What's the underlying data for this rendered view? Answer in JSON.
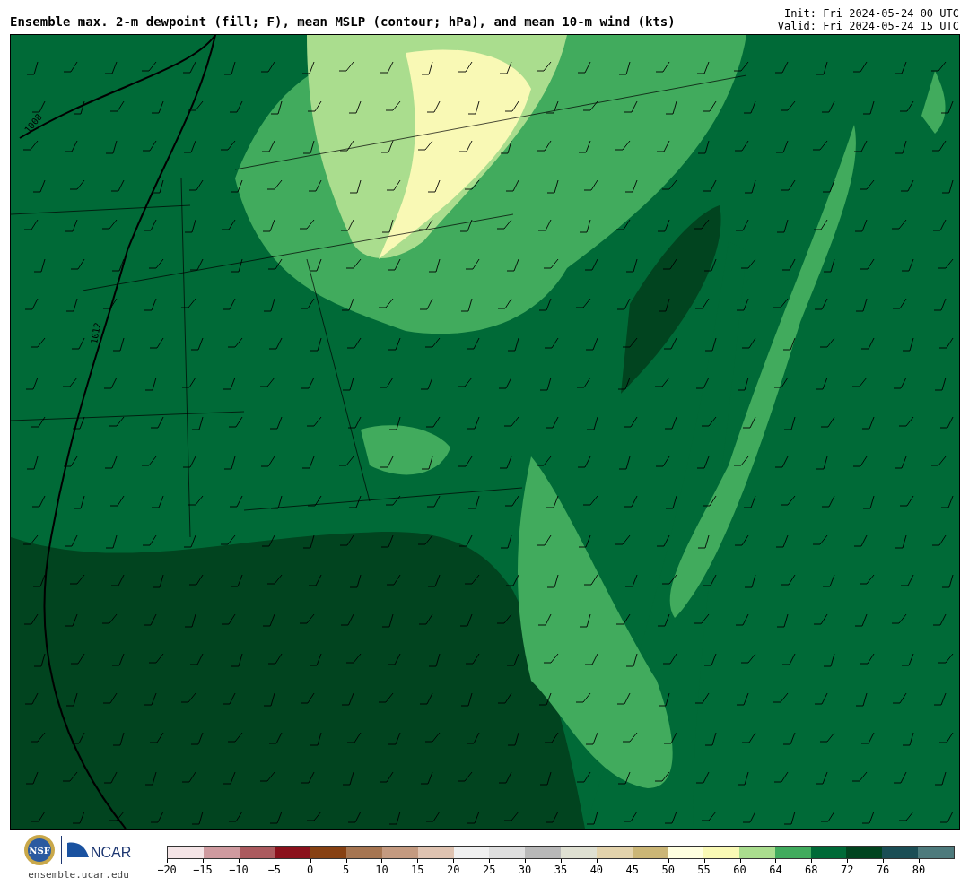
{
  "title": "Ensemble max. 2-m dewpoint (fill; F), mean MSLP (contour; hPa), and mean 10-m wind (kts)",
  "init": "Init: Fri 2024-05-24 00 UTC",
  "valid": "Valid: Fri 2024-05-24 15 UTC",
  "map": {
    "contours": [
      {
        "label": "1008"
      },
      {
        "label": "1012"
      }
    ]
  },
  "logos": {
    "left": "NSF",
    "right": "NCAR",
    "url": "ensemble.ucar.edu"
  },
  "colorbar": [
    {
      "label": "−20",
      "color": "#f4e4e6"
    },
    {
      "label": "−15",
      "color": "#cf9a9f"
    },
    {
      "label": "−10",
      "color": "#ab5a5e"
    },
    {
      "label": "−5",
      "color": "#8b111c"
    },
    {
      "label": "0",
      "color": "#874113"
    },
    {
      "label": "5",
      "color": "#a67551"
    },
    {
      "label": "10",
      "color": "#c49a80"
    },
    {
      "label": "15",
      "color": "#dfc3b1"
    },
    {
      "label": "20",
      "color": "#f0f0f0"
    },
    {
      "label": "25",
      "color": "#dedede"
    },
    {
      "label": "30",
      "color": "#b8b8b8"
    },
    {
      "label": "35",
      "color": "#dfe0d2"
    },
    {
      "label": "40",
      "color": "#e3d3ac"
    },
    {
      "label": "45",
      "color": "#cbb676"
    },
    {
      "label": "50",
      "color": "#ffffe0"
    },
    {
      "label": "55",
      "color": "#f9f9b5"
    },
    {
      "label": "60",
      "color": "#aadd8e"
    },
    {
      "label": "64",
      "color": "#41ab5d"
    },
    {
      "label": "68",
      "color": "#006a37"
    },
    {
      "label": "72",
      "color": "#01441f"
    },
    {
      "label": "76",
      "color": "#1b4e55"
    },
    {
      "label": "80",
      "color": "#4d7a7c"
    }
  ]
}
